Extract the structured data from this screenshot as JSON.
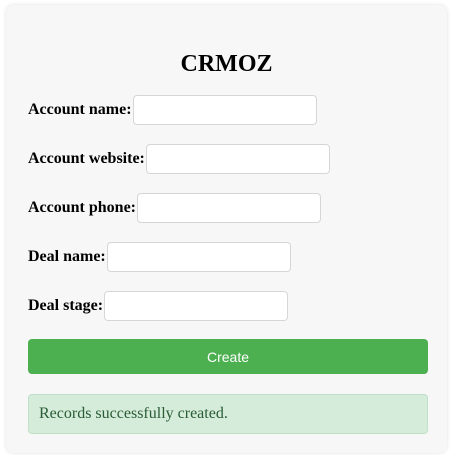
{
  "app": {
    "title": "CRMOZ"
  },
  "form": {
    "fields": [
      {
        "label": "Account name:",
        "value": ""
      },
      {
        "label": "Account website:",
        "value": ""
      },
      {
        "label": "Account phone:",
        "value": ""
      },
      {
        "label": "Deal name:",
        "value": ""
      },
      {
        "label": "Deal stage:",
        "value": ""
      }
    ],
    "submit_label": "Create"
  },
  "status": {
    "message": "Records successfully created.",
    "color": "#d4ecd9"
  },
  "colors": {
    "primary_button": "#4caf50",
    "background": "#f7f7f7"
  }
}
